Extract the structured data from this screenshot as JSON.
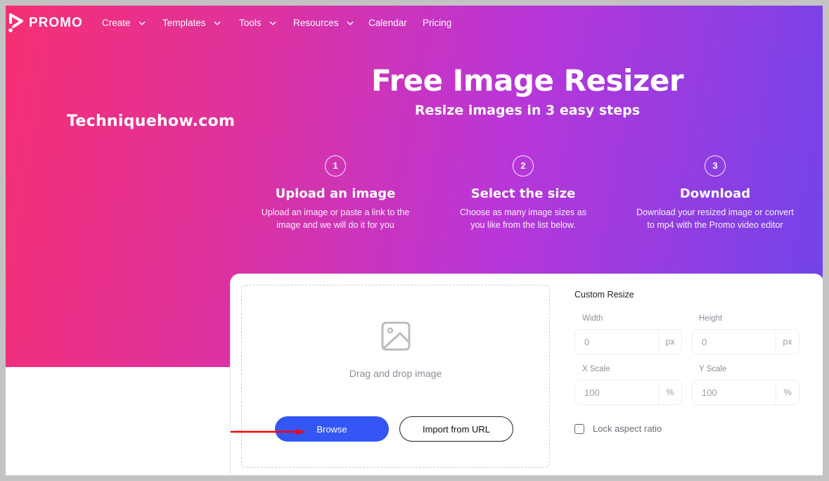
{
  "nav": {
    "brand": "PROMO",
    "items": [
      {
        "label": "Create",
        "has_dropdown": true
      },
      {
        "label": "Templates",
        "has_dropdown": true
      },
      {
        "label": "Tools",
        "has_dropdown": true
      },
      {
        "label": "Resources",
        "has_dropdown": true
      },
      {
        "label": "Calendar",
        "has_dropdown": false
      },
      {
        "label": "Pricing",
        "has_dropdown": false
      }
    ]
  },
  "watermark": "Techniquehow.com",
  "hero": {
    "title": "Free Image Resizer",
    "subtitle": "Resize images in 3 easy steps",
    "steps": [
      {
        "number": "1",
        "title": "Upload an image",
        "desc_line1": "Upload an image or paste a link to the",
        "desc_line2": "image and we will do it for you"
      },
      {
        "number": "2",
        "title": "Select the size",
        "desc_line1": "Choose as many image sizes as",
        "desc_line2": "you like from the list below."
      },
      {
        "number": "3",
        "title": "Download",
        "desc_line1": "Download your resized image or convert",
        "desc_line2": "to mp4 with the Promo video editor"
      }
    ]
  },
  "upload": {
    "icon": "image-icon",
    "drag_text": "Drag and drop image",
    "browse_label": "Browse",
    "import_label": "Import from URL"
  },
  "custom_resize": {
    "title": "Custom Resize",
    "width": {
      "label": "Width",
      "value": "0",
      "unit": "px"
    },
    "height": {
      "label": "Height",
      "value": "0",
      "unit": "px"
    },
    "x_scale": {
      "label": "X Scale",
      "value": "100",
      "unit": "%"
    },
    "y_scale": {
      "label": "Y Scale",
      "value": "100",
      "unit": "%"
    },
    "lock_label": "Lock aspect ratio",
    "lock_checked": false
  },
  "colors": {
    "gradient_start": "#f62f73",
    "gradient_mid": "#b936d8",
    "gradient_end": "#6f44ea",
    "browse_button": "#3356f5",
    "annotation_arrow": "#ff0000"
  }
}
